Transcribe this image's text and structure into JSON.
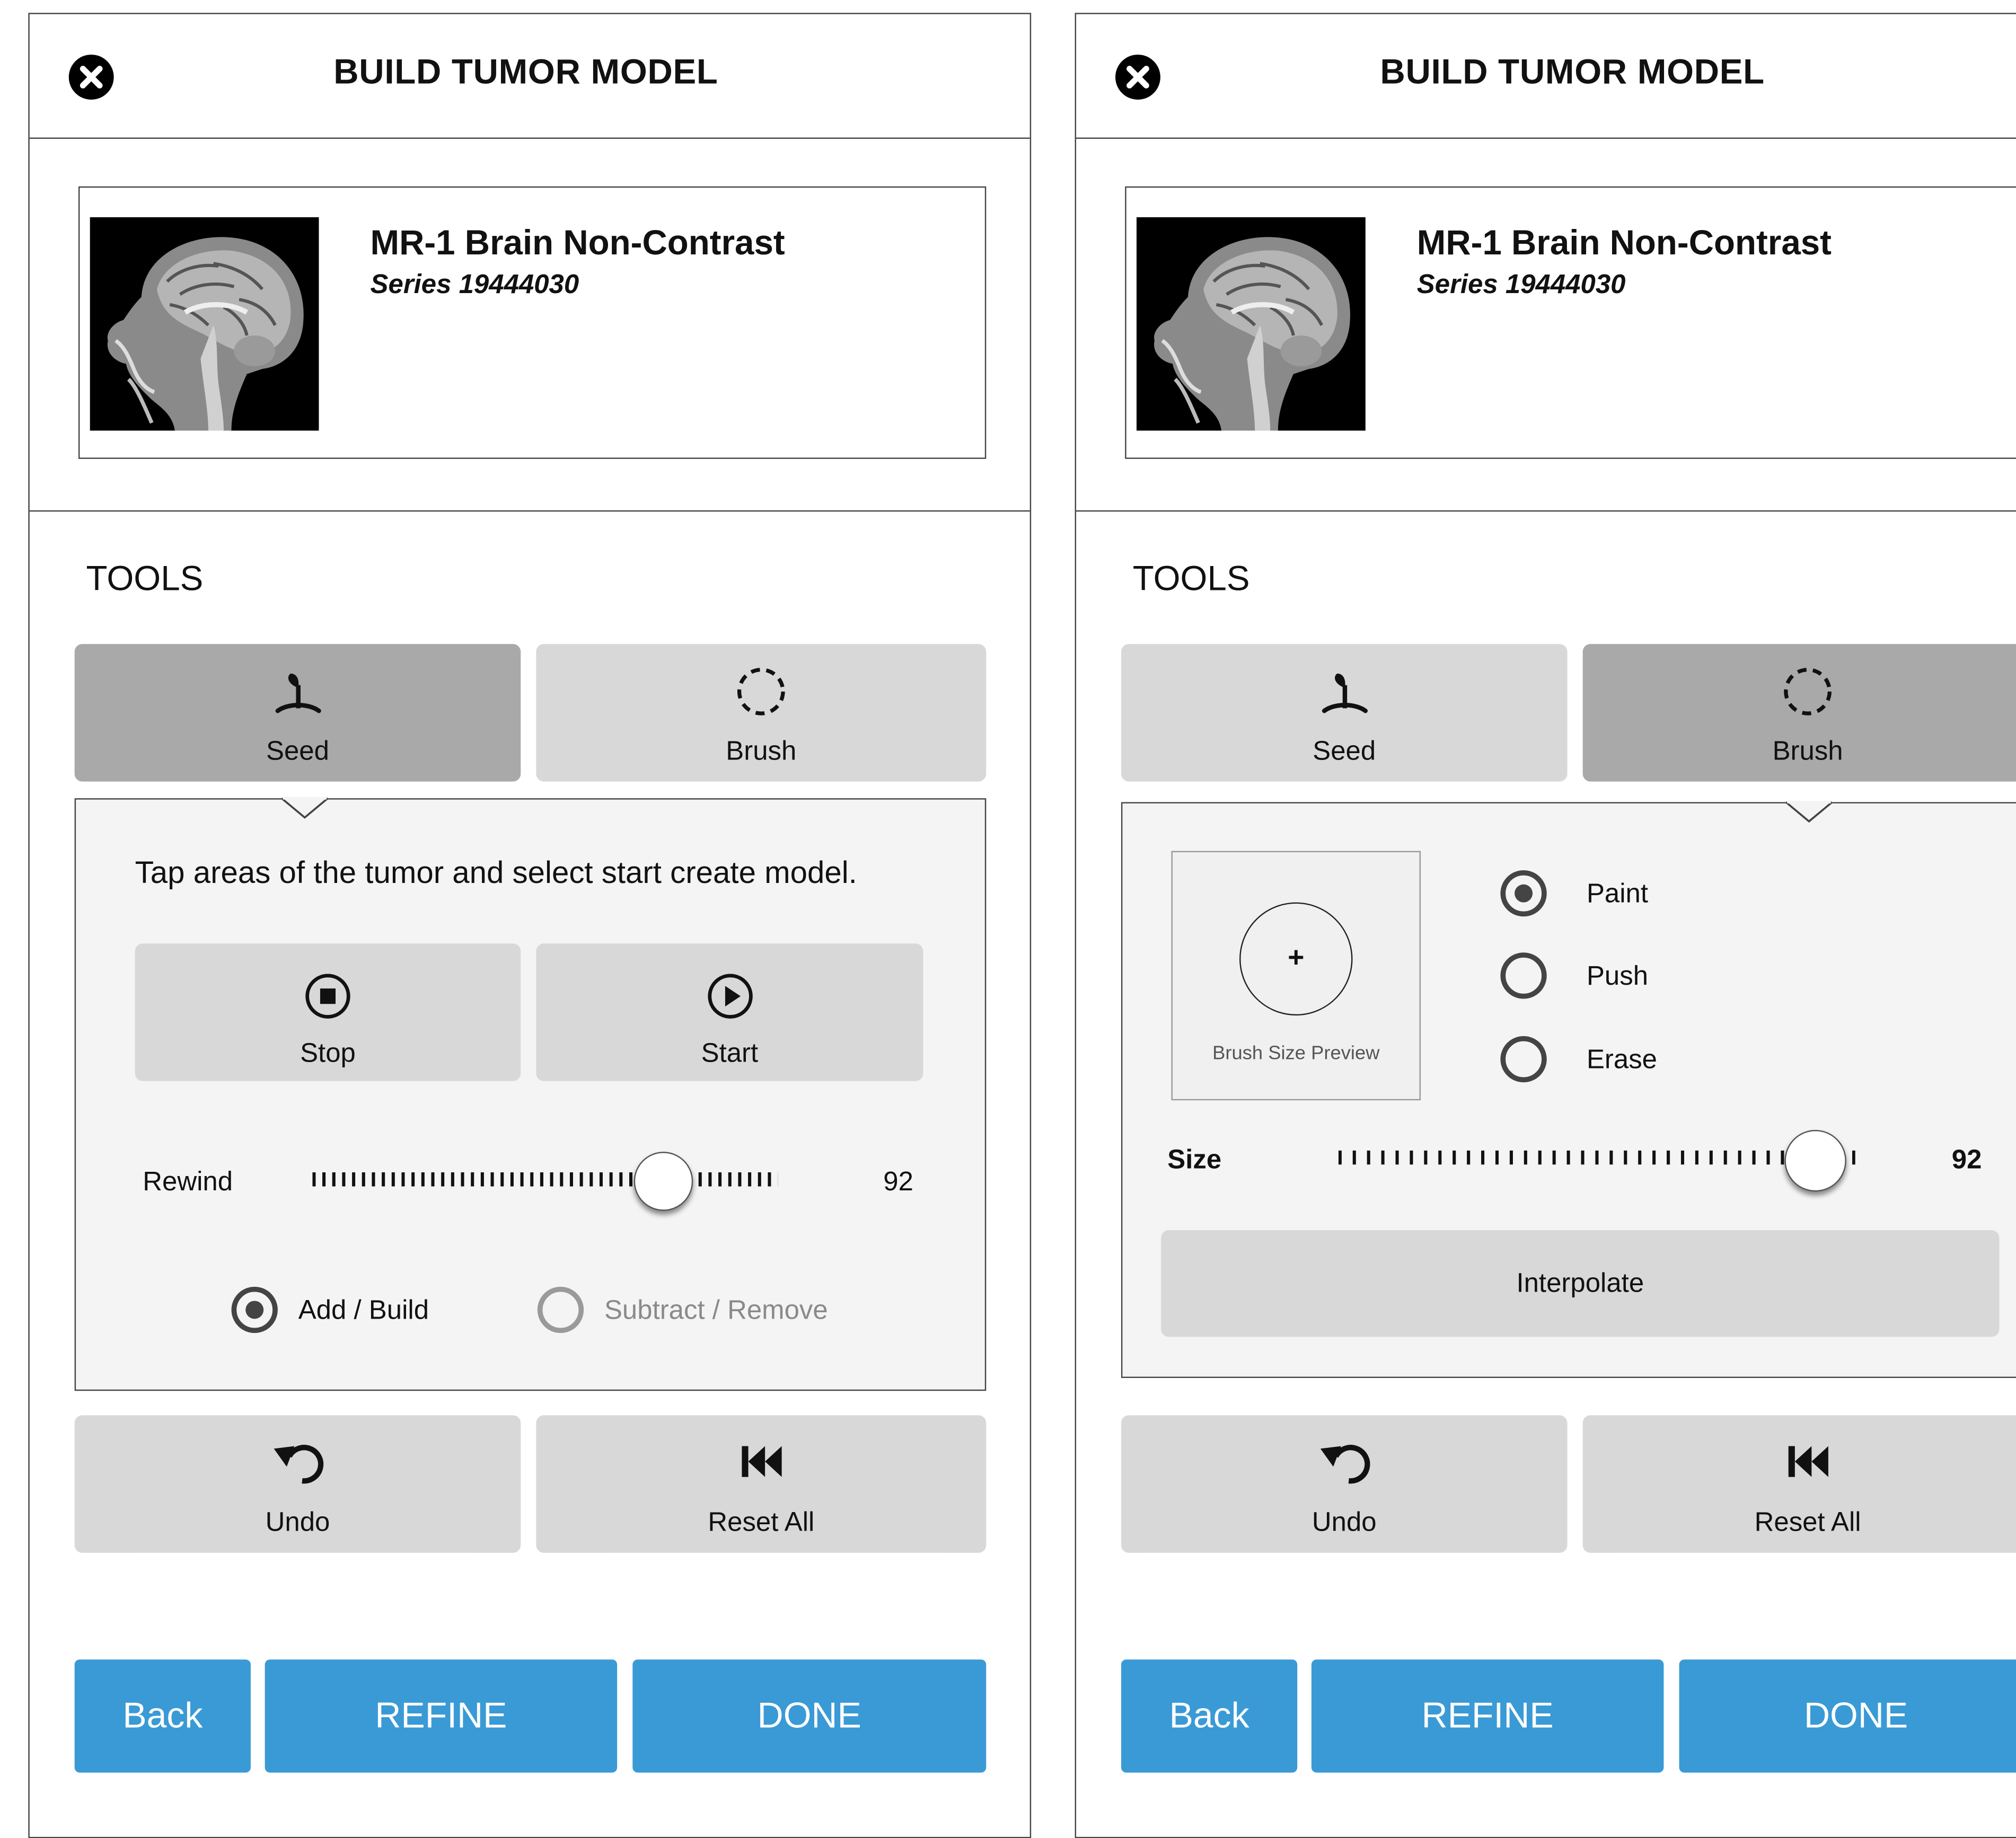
{
  "colors": {
    "footer_button": "#3a9ad6",
    "tool_inactive": "#d8d8d8",
    "tool_active": "#a9a9a9",
    "sub_panel": "#f4f4f4"
  },
  "screens": [
    {
      "title": "BUILD TUMOR MODEL",
      "close_icon": "close-circle-icon",
      "series": {
        "name": "MR-1 Brain Non-Contrast",
        "number": "Series 19444030",
        "thumbnail": "mri-brain-sagittal"
      },
      "tools_label": "TOOLS",
      "tools": [
        {
          "label": "Seed",
          "icon": "seed-icon",
          "active": true
        },
        {
          "label": "Brush",
          "icon": "dashed-circle-icon",
          "active": false
        }
      ],
      "seed_panel": {
        "instruction": "Tap areas of the tumor and select start create model.",
        "stop_label": "Stop",
        "start_label": "Start",
        "rewind_label": "Rewind",
        "rewind_value": "92",
        "rewind_fraction": 0.75,
        "mode_options": [
          {
            "label": "Add / Build",
            "selected": true,
            "enabled": true
          },
          {
            "label": "Subtract / Remove",
            "selected": false,
            "enabled": false
          }
        ]
      },
      "undo_label": "Undo",
      "reset_label": "Reset All",
      "footer": {
        "back": "Back",
        "refine": "REFINE",
        "done": "DONE"
      }
    },
    {
      "title": "BUILD TUMOR MODEL",
      "close_icon": "close-circle-icon",
      "series": {
        "name": "MR-1 Brain Non-Contrast",
        "number": "Series 19444030",
        "thumbnail": "mri-brain-sagittal"
      },
      "tools_label": "TOOLS",
      "tools": [
        {
          "label": "Seed",
          "icon": "seed-icon",
          "active": false
        },
        {
          "label": "Brush",
          "icon": "dashed-circle-icon",
          "active": true
        }
      ],
      "brush_panel": {
        "preview_label": "Brush Size Preview",
        "preview_symbol": "+",
        "modes": [
          {
            "label": "Paint",
            "selected": true
          },
          {
            "label": "Push",
            "selected": false
          },
          {
            "label": "Erase",
            "selected": false
          }
        ],
        "size_label": "Size",
        "size_value": "92",
        "size_fraction": 0.92,
        "interpolate_label": "Interpolate"
      },
      "undo_label": "Undo",
      "reset_label": "Reset All",
      "footer": {
        "back": "Back",
        "refine": "REFINE",
        "done": "DONE"
      }
    }
  ]
}
